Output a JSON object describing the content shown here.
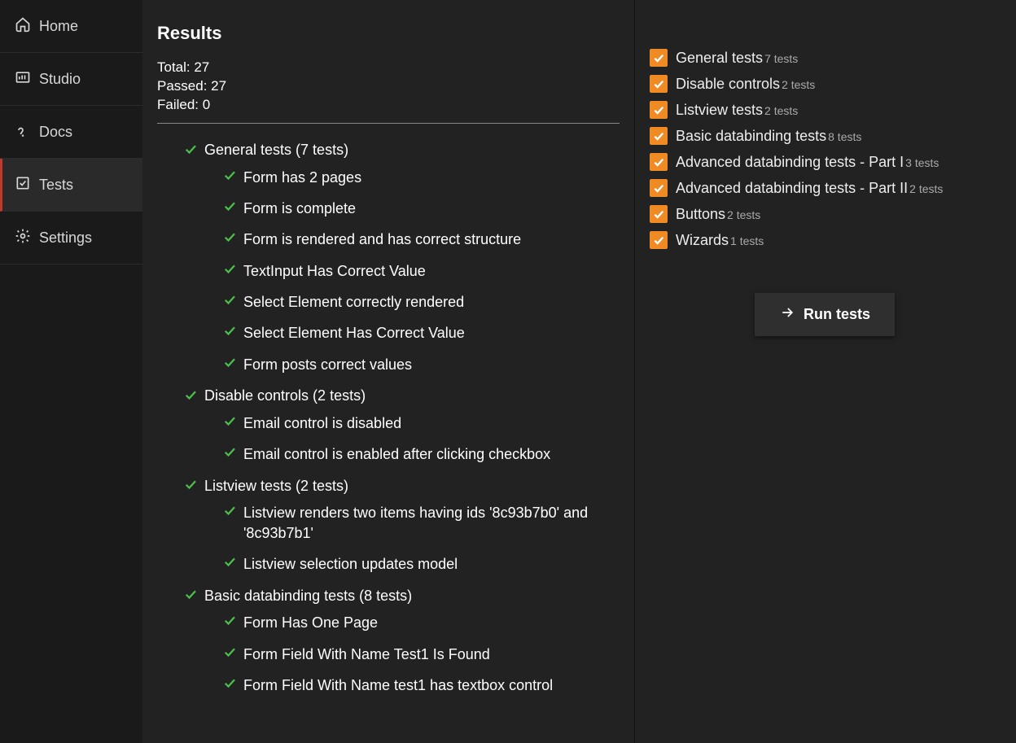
{
  "sidebar": {
    "items": [
      {
        "label": "Home",
        "icon": "home-icon"
      },
      {
        "label": "Studio",
        "icon": "studio-icon"
      },
      {
        "label": "Docs",
        "icon": "docs-icon"
      },
      {
        "label": "Tests",
        "icon": "tests-icon",
        "active": true
      },
      {
        "label": "Settings",
        "icon": "settings-icon"
      }
    ]
  },
  "results": {
    "title": "Results",
    "total_label": "Total: 27",
    "passed_label": "Passed: 27",
    "failed_label": "Failed: 0",
    "groups": [
      {
        "label": "General tests (7 tests)",
        "tests": [
          "Form has 2 pages",
          "Form is complete",
          "Form is rendered and has correct structure",
          "TextInput Has Correct Value",
          "Select Element correctly rendered",
          "Select Element Has Correct Value",
          "Form posts correct values"
        ]
      },
      {
        "label": "Disable controls (2 tests)",
        "tests": [
          "Email control is disabled",
          "Email control is enabled after clicking checkbox"
        ]
      },
      {
        "label": "Listview tests (2 tests)",
        "tests": [
          "Listview renders two items having ids '8c93b7b0' and '8c93b7b1'",
          "Listview selection updates model"
        ]
      },
      {
        "label": "Basic databinding tests (8 tests)",
        "tests": [
          "Form Has One Page",
          "Form Field With Name Test1 Is Found",
          "Form Field With Name test1 has textbox control"
        ]
      }
    ]
  },
  "suites": [
    {
      "label": "General tests",
      "count": "7 tests",
      "checked": true
    },
    {
      "label": "Disable controls",
      "count": "2 tests",
      "checked": true
    },
    {
      "label": "Listview tests",
      "count": "2 tests",
      "checked": true
    },
    {
      "label": "Basic databinding tests",
      "count": "8 tests",
      "checked": true
    },
    {
      "label": "Advanced databinding tests - Part I",
      "count": "3 tests",
      "checked": true
    },
    {
      "label": "Advanced databinding tests - Part II",
      "count": "2 tests",
      "checked": true
    },
    {
      "label": "Buttons",
      "count": "2 tests",
      "checked": true
    },
    {
      "label": "Wizards",
      "count": "1 tests",
      "checked": true
    }
  ],
  "run_button": "Run tests"
}
